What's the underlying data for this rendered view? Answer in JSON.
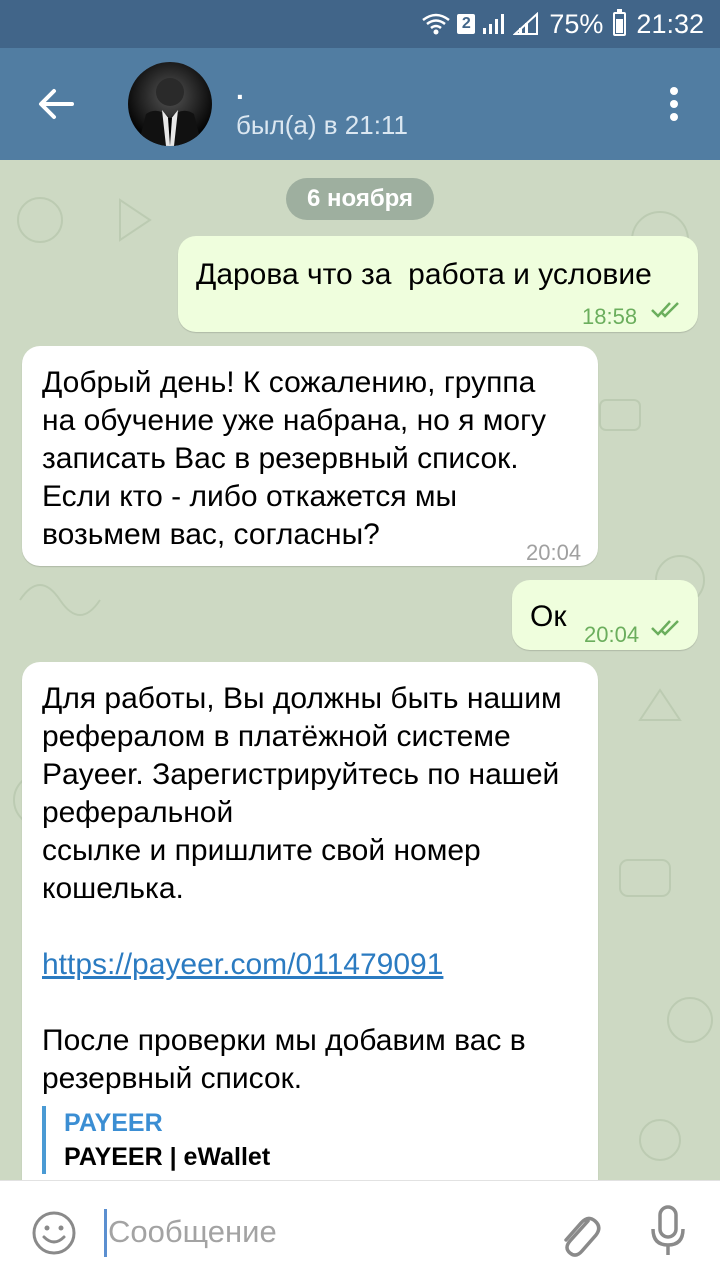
{
  "status_bar": {
    "sim_badge": "2",
    "battery": "75%",
    "time": "21:32",
    "battery_level": 0.75
  },
  "header": {
    "name": ".",
    "status": "был(а) в 21:11"
  },
  "chat": {
    "date": "6 ноября",
    "messages": [
      {
        "direction": "out",
        "text": "Дарова что за  работа и условие",
        "time": "18:58",
        "read": true
      },
      {
        "direction": "in",
        "text": "Добрый день! К сожалению, группа на обучение уже набрана, но я могу записать Вас в резервный список. Если кто - либо откажется мы возьмем вас, согласны?",
        "time": "20:04"
      },
      {
        "direction": "out",
        "text": "Ок",
        "time": "20:04",
        "read": true
      },
      {
        "direction": "in",
        "text_part1": "Для работы, Вы должны быть нашим рефералом в платёжной системе Payeer. Зарегистрируйтесь по нашей реферальной\nссылке и пришлите свой номер кошелька.",
        "link": "https://payeer.com/011479091",
        "text_part2": "После проверки мы добавим вас в резервный список.",
        "preview_site": "PAYEER",
        "preview_title": "PAYEER | eWallet"
      }
    ]
  },
  "input": {
    "placeholder": "Сообщение"
  },
  "colors": {
    "status_bar": "#416589",
    "app_bar": "#517da2",
    "outgoing_bubble": "#effedd",
    "incoming_bubble": "#ffffff",
    "link": "#2b7bc1",
    "read_ticks": "#6bae5d"
  },
  "icons": {
    "back": "arrow-left-icon",
    "menu": "more-vertical-icon",
    "emoji": "smile-icon",
    "attach": "paperclip-icon",
    "mic": "microphone-icon",
    "wifi": "wifi-icon",
    "signal": "signal-icon",
    "battery": "battery-icon"
  }
}
